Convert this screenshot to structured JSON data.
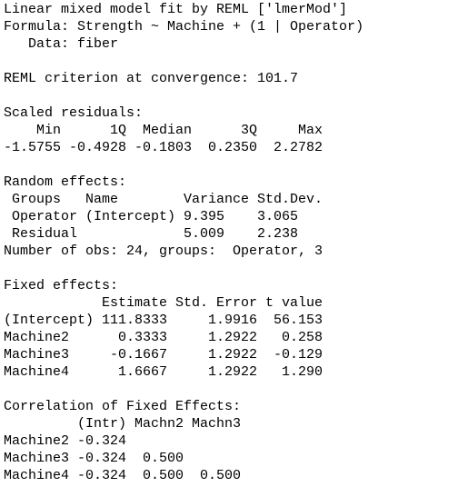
{
  "console": {
    "lines": [
      "Linear mixed model fit by REML ['lmerMod']",
      "Formula: Strength ~ Machine + (1 | Operator)",
      "   Data: fiber",
      "",
      "REML criterion at convergence: 101.7",
      "",
      "Scaled residuals:",
      "    Min      1Q  Median      3Q     Max",
      "-1.5755 -0.4928 -0.1803  0.2350  2.2782",
      "",
      "Random effects:",
      " Groups   Name        Variance Std.Dev.",
      " Operator (Intercept) 9.395    3.065   ",
      " Residual             5.009    2.238   ",
      "Number of obs: 24, groups:  Operator, 3",
      "",
      "Fixed effects:",
      "            Estimate Std. Error t value",
      "(Intercept) 111.8333     1.9916  56.153",
      "Machine2      0.3333     1.2922   0.258",
      "Machine3     -0.1667     1.2922  -0.129",
      "Machine4      1.6667     1.2922   1.290",
      "",
      "Correlation of Fixed Effects:",
      "         (Intr) Machn2 Machn3",
      "Machine2 -0.324              ",
      "Machine3 -0.324  0.500       ",
      "Machine4 -0.324  0.500  0.500"
    ]
  }
}
